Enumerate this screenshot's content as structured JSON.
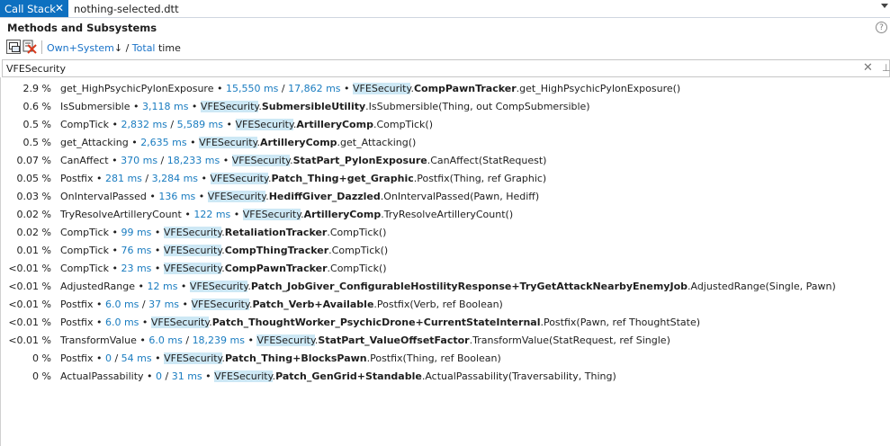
{
  "tabs": {
    "active_label": "Call Stack",
    "close_glyph": "✕",
    "inactive_label": "nothing-selected.dtt"
  },
  "header": {
    "title": "Methods and Subsystems",
    "help_glyph": "?"
  },
  "toolbar": {
    "mode_own": "Own+System",
    "mode_arrow": "↓",
    "mode_slash": " / ",
    "mode_total": "Total",
    "mode_time": " time"
  },
  "search": {
    "value": "VFESecurity",
    "clear_glyph": "✕",
    "pin_glyph": "⊥"
  },
  "colors": {
    "accent": "#0e70c0",
    "time_blue": "#1a7cc0",
    "highlight": "#cde8f5"
  },
  "rows": [
    {
      "pct": "2.9 %",
      "method": "get_HighPsychicPylonExposure",
      "own": "15,550 ms",
      "total": "17,862 ms",
      "ns": "VFESecurity",
      "cls": "CompPawnTracker",
      "tail": ".get_HighPsychicPylonExposure()"
    },
    {
      "pct": "0.6 %",
      "method": "IsSubmersible",
      "own": "3,118 ms",
      "total": "",
      "ns": "VFESecurity",
      "cls": "SubmersibleUtility",
      "tail": ".IsSubmersible(Thing, out CompSubmersible)"
    },
    {
      "pct": "0.5 %",
      "method": "CompTick",
      "own": "2,832 ms",
      "total": "5,589 ms",
      "ns": "VFESecurity",
      "cls": "ArtilleryComp",
      "tail": ".CompTick()"
    },
    {
      "pct": "0.5 %",
      "method": "get_Attacking",
      "own": "2,635 ms",
      "total": "",
      "ns": "VFESecurity",
      "cls": "ArtilleryComp",
      "tail": ".get_Attacking()"
    },
    {
      "pct": "0.07 %",
      "method": "CanAffect",
      "own": "370 ms",
      "total": "18,233 ms",
      "ns": "VFESecurity",
      "cls": "StatPart_PylonExposure",
      "tail": ".CanAffect(StatRequest)"
    },
    {
      "pct": "0.05 %",
      "method": "Postfix",
      "own": "281 ms",
      "total": "3,284 ms",
      "ns": "VFESecurity",
      "cls": "Patch_Thing+get_Graphic",
      "tail": ".Postfix(Thing, ref Graphic)"
    },
    {
      "pct": "0.03 %",
      "method": "OnIntervalPassed",
      "own": "136 ms",
      "total": "",
      "ns": "VFESecurity",
      "cls": "HediffGiver_Dazzled",
      "tail": ".OnIntervalPassed(Pawn, Hediff)"
    },
    {
      "pct": "0.02 %",
      "method": "TryResolveArtilleryCount",
      "own": "122 ms",
      "total": "",
      "ns": "VFESecurity",
      "cls": "ArtilleryComp",
      "tail": ".TryResolveArtilleryCount()"
    },
    {
      "pct": "0.02 %",
      "method": "CompTick",
      "own": "99 ms",
      "total": "",
      "ns": "VFESecurity",
      "cls": "RetaliationTracker",
      "tail": ".CompTick()"
    },
    {
      "pct": "0.01 %",
      "method": "CompTick",
      "own": "76 ms",
      "total": "",
      "ns": "VFESecurity",
      "cls": "CompThingTracker",
      "tail": ".CompTick()"
    },
    {
      "pct": "<0.01 %",
      "method": "CompTick",
      "own": "23 ms",
      "total": "",
      "ns": "VFESecurity",
      "cls": "CompPawnTracker",
      "tail": ".CompTick()"
    },
    {
      "pct": "<0.01 %",
      "method": "AdjustedRange",
      "own": "12 ms",
      "total": "",
      "ns": "VFESecurity",
      "cls": "Patch_JobGiver_ConfigurableHostilityResponse+TryGetAttackNearbyEnemyJob",
      "tail": ".AdjustedRange(Single, Pawn)"
    },
    {
      "pct": "<0.01 %",
      "method": "Postfix",
      "own": "6.0 ms",
      "total": "37 ms",
      "ns": "VFESecurity",
      "cls": "Patch_Verb+Available",
      "tail": ".Postfix(Verb, ref Boolean)"
    },
    {
      "pct": "<0.01 %",
      "method": "Postfix",
      "own": "6.0 ms",
      "total": "",
      "ns": "VFESecurity",
      "cls": "Patch_ThoughtWorker_PsychicDrone+CurrentStateInternal",
      "tail": ".Postfix(Pawn, ref ThoughtState)"
    },
    {
      "pct": "<0.01 %",
      "method": "TransformValue",
      "own": "6.0 ms",
      "total": "18,239 ms",
      "ns": "VFESecurity",
      "cls": "StatPart_ValueOffsetFactor",
      "tail": ".TransformValue(StatRequest, ref Single)"
    },
    {
      "pct": "0 %",
      "method": "Postfix",
      "own": "0",
      "total": "54 ms",
      "ns": "VFESecurity",
      "cls": "Patch_Thing+BlocksPawn",
      "tail": ".Postfix(Thing, ref Boolean)"
    },
    {
      "pct": "0 %",
      "method": "ActualPassability",
      "own": "0",
      "total": "31 ms",
      "ns": "VFESecurity",
      "cls": "Patch_GenGrid+Standable",
      "tail": ".ActualPassability(Traversability, Thing)"
    }
  ]
}
